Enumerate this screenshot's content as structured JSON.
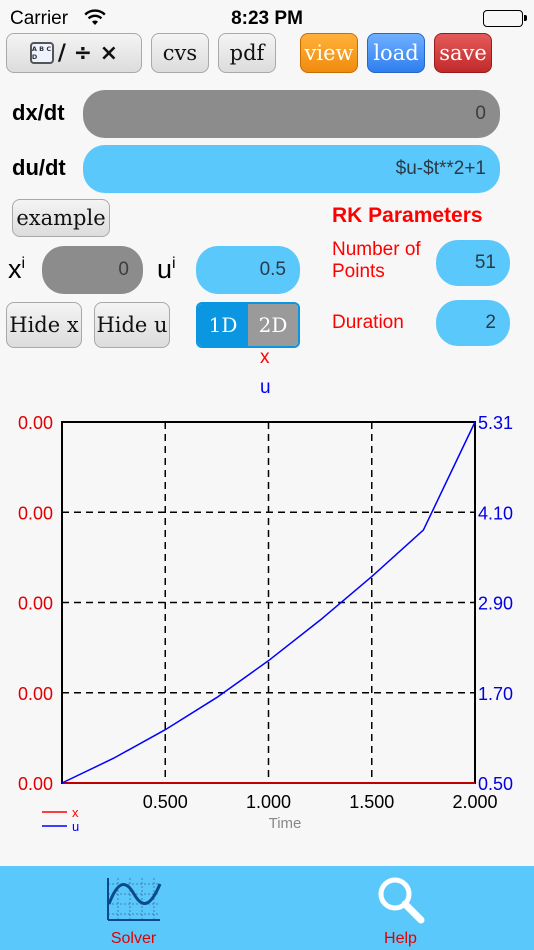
{
  "status": {
    "carrier": "Carrier",
    "time": "8:23 PM"
  },
  "toolbar": {
    "ops_label": "/ ÷ ×",
    "abcd": "A B C D",
    "cvs": "cvs",
    "pdf": "pdf",
    "view": "view",
    "load": "load",
    "save": "save"
  },
  "equations": {
    "dx_label": "dx/dt",
    "dx_value": "0",
    "du_label": "du/dt",
    "du_value": "$u-$t**2+1"
  },
  "example_button": "example",
  "initial": {
    "x_label": "x",
    "x_sup": "i",
    "x_value": "0",
    "u_label": "u",
    "u_sup": "i",
    "u_value": "0.5"
  },
  "rk": {
    "title": "RK Parameters",
    "points_label": "Number of Points",
    "points_value": "51",
    "duration_label": "Duration",
    "duration_value": "2"
  },
  "hide_x": "Hide x",
  "hide_u": "Hide u",
  "mode": {
    "one": "1D",
    "two": "2D",
    "selected": "1D"
  },
  "legend_top": {
    "x": "x",
    "u": "u"
  },
  "colors": {
    "x_series": "#ff0000",
    "u_series": "#0000ff",
    "accent": "#5ac8fa"
  },
  "chart_data": {
    "type": "line",
    "xlabel": "Time",
    "x_ticks": [
      "0.500",
      "1.000",
      "1.500",
      "2.000"
    ],
    "xlim": [
      0,
      2
    ],
    "left_axis": {
      "series": "x",
      "ticks": [
        "0.00",
        "0.00",
        "0.00",
        "0.00",
        "0.00"
      ]
    },
    "right_axis": {
      "series": "u",
      "ticks": [
        "5.31",
        "4.10",
        "2.90",
        "1.70",
        "0.50"
      ],
      "ylim": [
        0.5,
        5.31
      ]
    },
    "grid": true,
    "legend": "bottom-left",
    "series": [
      {
        "name": "x",
        "axis": "left",
        "color": "#ff0000",
        "x": [
          0,
          2
        ],
        "y": [
          0,
          0
        ]
      },
      {
        "name": "u",
        "axis": "right",
        "color": "#0000ff",
        "x": [
          0,
          0.25,
          0.5,
          0.75,
          1.0,
          1.25,
          1.5,
          1.75,
          2.0
        ],
        "y": [
          0.5,
          0.83,
          1.21,
          1.64,
          2.13,
          2.67,
          3.25,
          3.87,
          5.31
        ]
      }
    ]
  },
  "tabs": {
    "solver": "Solver",
    "help": "Help"
  }
}
